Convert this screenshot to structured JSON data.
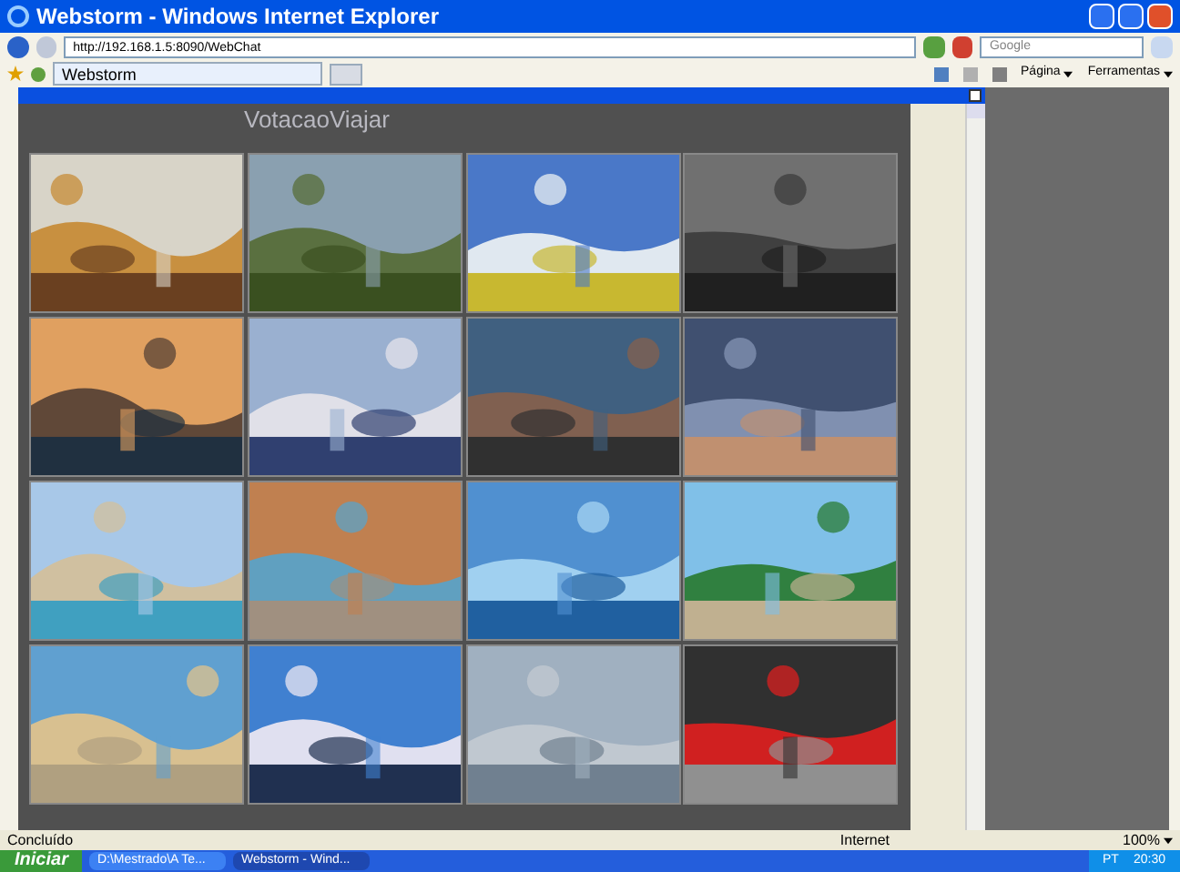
{
  "window": {
    "title": "Webstorm - Windows Internet Explorer"
  },
  "address_bar": {
    "url": "http://192.168.1.5:8090/WebChat",
    "search_placeholder": "Google"
  },
  "tabs": [
    {
      "label": "Webstorm",
      "selected": true
    }
  ],
  "command_bar": {
    "page_menu": "Página",
    "tools_menu": "Ferramentas"
  },
  "page": {
    "heading": "VotacaoViajar"
  },
  "status_bar": {
    "status": "Concluído",
    "zone": "Internet",
    "zoom": "100%"
  },
  "taskbar": {
    "start": "Iniciar",
    "items": [
      {
        "label": "D:\\Mestrado\\A Te...",
        "selected": false
      },
      {
        "label": "Webstorm - Wind...",
        "selected": true
      }
    ],
    "language": "PT",
    "clock": "20:30"
  }
}
